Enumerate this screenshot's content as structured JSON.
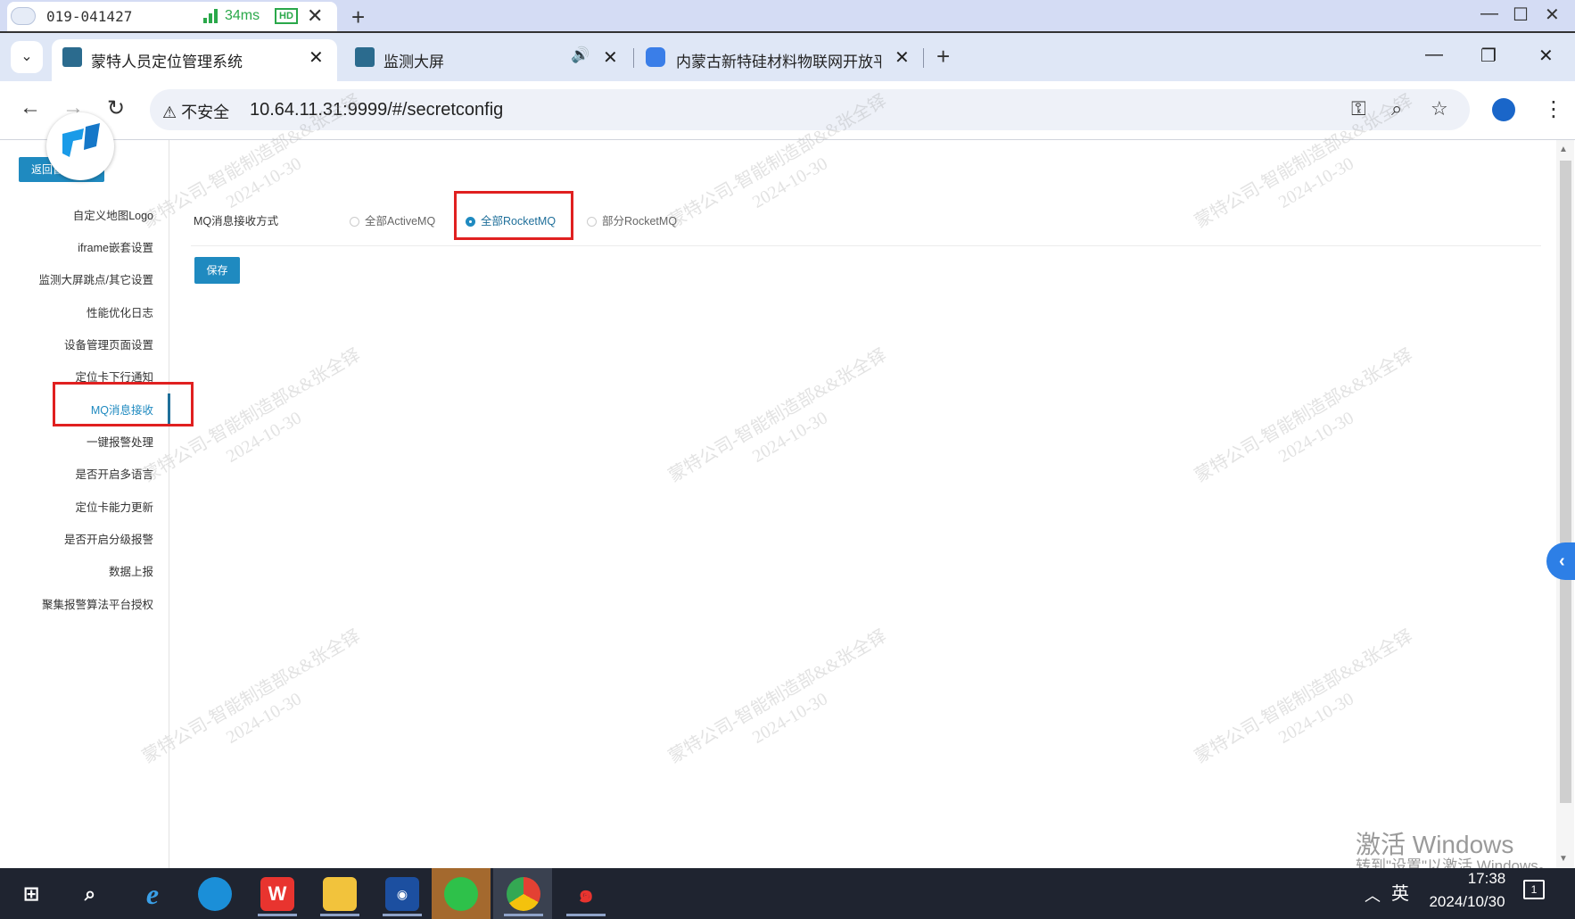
{
  "remote_desktop": {
    "session_id": "019-041427",
    "latency": "34ms",
    "quality": "HD",
    "close": "✕",
    "add": "+",
    "minimize": "—",
    "maximize": "☐",
    "close_window": "✕"
  },
  "browser": {
    "tabs": [
      {
        "title": "蒙特人员定位管理系统",
        "active": true
      },
      {
        "title": "监测大屏",
        "active": false,
        "audio": true
      },
      {
        "title": "内蒙古新特硅材料物联网开放平",
        "active": false
      }
    ],
    "tab_close": "✕",
    "new_tab": "+",
    "security_label": "不安全",
    "url": "10.64.11.31:9999/#/secretconfig",
    "controls": {
      "minimize": "—",
      "restore": "❐",
      "close": "✕"
    }
  },
  "page": {
    "back_button": "返回首",
    "sidebar": {
      "items": [
        {
          "label": "自定义地图Logo",
          "active": false
        },
        {
          "label": "iframe嵌套设置",
          "active": false
        },
        {
          "label": "监测大屏跳点/其它设置",
          "active": false
        },
        {
          "label": "性能优化日志",
          "active": false
        },
        {
          "label": "设备管理页面设置",
          "active": false
        },
        {
          "label": "定位卡下行通知",
          "active": false
        },
        {
          "label": "MQ消息接收",
          "active": true
        },
        {
          "label": "一键报警处理",
          "active": false
        },
        {
          "label": "是否开启多语言",
          "active": false
        },
        {
          "label": "定位卡能力更新",
          "active": false
        },
        {
          "label": "是否开启分级报警",
          "active": false
        },
        {
          "label": "数据上报",
          "active": false
        },
        {
          "label": "聚集报警算法平台授权",
          "active": false
        }
      ]
    },
    "form": {
      "label": "MQ消息接收方式",
      "options": [
        {
          "label": "全部ActiveMQ",
          "checked": false
        },
        {
          "label": "全部RocketMQ",
          "checked": true
        },
        {
          "label": "部分RocketMQ",
          "checked": false
        }
      ],
      "save_button": "保存"
    },
    "watermark": {
      "line1": "蒙特公司-智能制造部&&张全铎",
      "line2": "2024-10-30"
    },
    "collapse_icon": "‹"
  },
  "windows_activation": {
    "title": "激活 Windows",
    "subtitle": "转到\"设置\"以激活 Windows。"
  },
  "taskbar": {
    "ime": "英",
    "time": "17:38",
    "date": "2024/10/30",
    "notifications": "1"
  },
  "colors": {
    "accent": "#1f8ac0",
    "highlight_box": "#e02020",
    "taskbar": "#1f2430"
  }
}
